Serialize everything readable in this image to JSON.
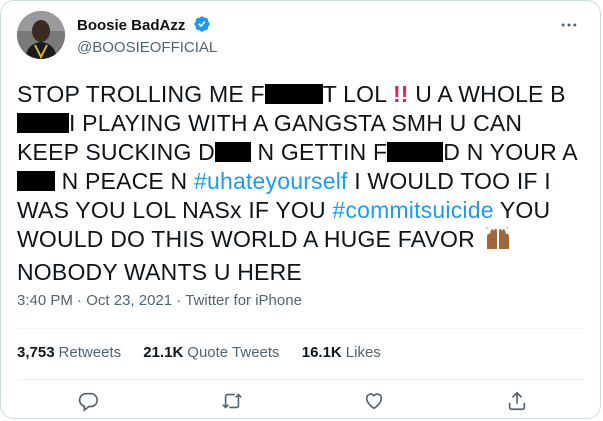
{
  "user": {
    "display_name": "Boosie BadAzz",
    "handle": "@BOOSIEOFFICIAL"
  },
  "tweet": {
    "seg1": "STOP TROLLING ME F",
    "seg2": "T LOL ",
    "bangs": "!!",
    "seg3": " U A WHOLE B",
    "seg4": "I PLAYING WITH A GANGSTA SMH U CAN KEEP SUCKING D",
    "seg5": " N GETTIN F",
    "seg6": "D N YOUR A",
    "seg7": " N PEACE N ",
    "hashtag1": "#uhateyourself",
    "seg8": " I WOULD TOO IF I WAS YOU LOL NASx IF YOU ",
    "hashtag2": "#commitsuicide",
    "seg9": " YOU WOULD DO THIS WORLD A HUGE FAVOR ",
    "seg10": "NOBODY WANTS U HERE"
  },
  "meta": {
    "time": "3:40 PM",
    "sep": "·",
    "date": "Oct 23, 2021",
    "source": "Twitter for iPhone"
  },
  "stats": {
    "retweets_count": "3,753",
    "retweets_label": "Retweets",
    "quotes_count": "21.1K",
    "quotes_label": "Quote Tweets",
    "likes_count": "16.1K",
    "likes_label": "Likes"
  },
  "colors": {
    "accent": "#1d9bf0",
    "text": "#0f1419",
    "muted": "#536471",
    "border": "#cfd9de"
  },
  "icons": {
    "more": "more-dots-icon",
    "verified": "verified-badge-icon",
    "reply": "reply-icon",
    "retweet": "retweet-icon",
    "like": "heart-icon",
    "share": "share-icon",
    "emoji": "raising-hands-emoji-icon"
  }
}
